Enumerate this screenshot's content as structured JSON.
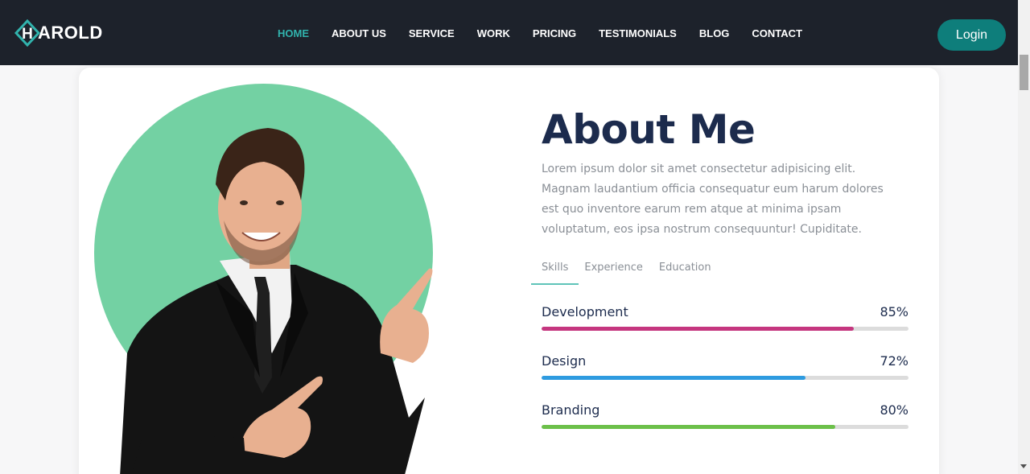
{
  "brand": {
    "name_rest": "AROLD",
    "logo_letter": "H",
    "accent_color": "#31b3ad"
  },
  "nav": {
    "items": [
      {
        "label": "HOME",
        "active": true
      },
      {
        "label": "ABOUT US",
        "active": false
      },
      {
        "label": "SERVICE",
        "active": false
      },
      {
        "label": "WORK",
        "active": false
      },
      {
        "label": "PRICING",
        "active": false
      },
      {
        "label": "TESTIMONIALS",
        "active": false
      },
      {
        "label": "BLOG",
        "active": false
      },
      {
        "label": "CONTACT",
        "active": false
      }
    ],
    "login_label": "Login",
    "login_color": "#0e7e7b"
  },
  "about": {
    "title": "About Me",
    "text": "Lorem ipsum dolor sit amet consectetur adipisicing elit. Magnam laudantium officia consequatur eum harum dolores est quo inventore earum rem atque at minima ipsam voluptatum, eos ipsa nostrum consequuntur! Cupiditate.",
    "image_icon": "person-photo",
    "circle_color": "#73d1a3"
  },
  "tabs": [
    {
      "label": "Skills",
      "active": true
    },
    {
      "label": "Experience",
      "active": false
    },
    {
      "label": "Education",
      "active": false
    }
  ],
  "skills": [
    {
      "name": "Development",
      "percent_label": "85%",
      "value": 0.85,
      "color": "#c5367f"
    },
    {
      "name": "Design",
      "percent_label": "72%",
      "value": 0.72,
      "color": "#2e9be0"
    },
    {
      "name": "Branding",
      "percent_label": "80%",
      "value": 0.8,
      "color": "#6cc04a"
    }
  ]
}
